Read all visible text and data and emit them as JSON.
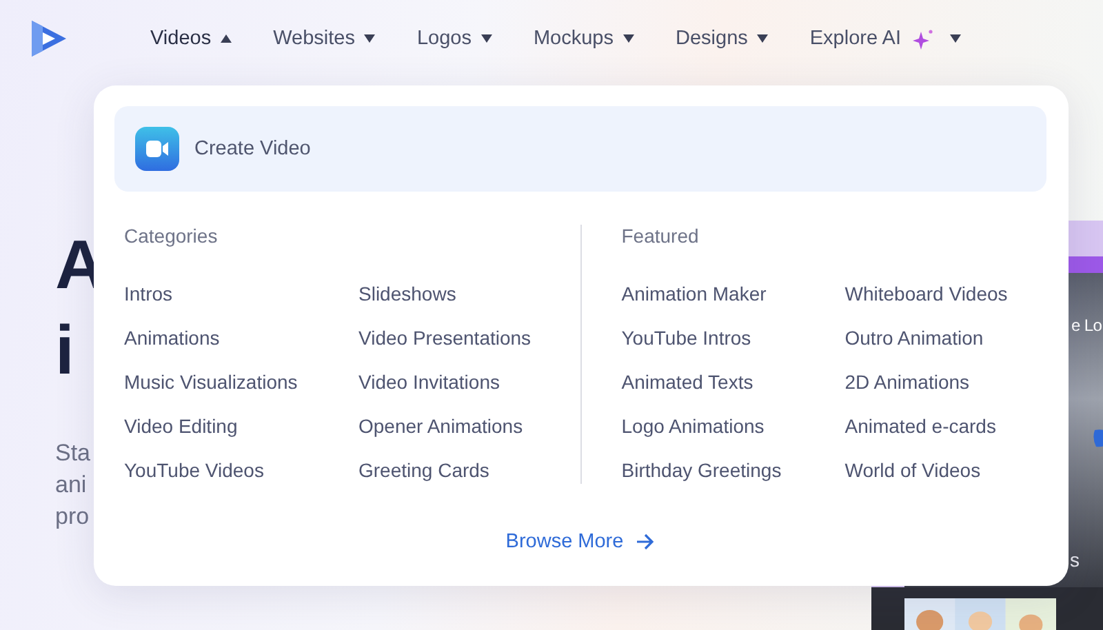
{
  "nav": {
    "items": [
      {
        "label": "Videos",
        "expanded": true,
        "kind": "plain"
      },
      {
        "label": "Websites",
        "expanded": false,
        "kind": "plain"
      },
      {
        "label": "Logos",
        "expanded": false,
        "kind": "plain"
      },
      {
        "label": "Mockups",
        "expanded": false,
        "kind": "plain"
      },
      {
        "label": "Designs",
        "expanded": false,
        "kind": "plain"
      },
      {
        "label": "Explore AI",
        "expanded": false,
        "kind": "ai"
      }
    ]
  },
  "hero": {
    "title_lines": [
      "A",
      "i"
    ],
    "text_lines": [
      "Sta",
      "ani",
      "pro"
    ]
  },
  "preview": {
    "caption": "e Lo",
    "footer": "s"
  },
  "dropdown": {
    "create": {
      "label": "Create Video"
    },
    "sections": [
      {
        "heading": "Categories",
        "items": [
          "Intros",
          "Slideshows",
          "Animations",
          "Video Presentations",
          "Music Visualizations",
          "Video Invitations",
          "Video Editing",
          "Opener Animations",
          "YouTube Videos",
          "Greeting Cards"
        ]
      },
      {
        "heading": "Featured",
        "items": [
          "Animation Maker",
          "Whiteboard Videos",
          "YouTube Intros",
          "Outro Animation",
          "Animated Texts",
          "2D Animations",
          "Logo Animations",
          "Animated e-cards",
          "Birthday Greetings",
          "World of Videos"
        ]
      }
    ],
    "browse_more": "Browse More"
  }
}
